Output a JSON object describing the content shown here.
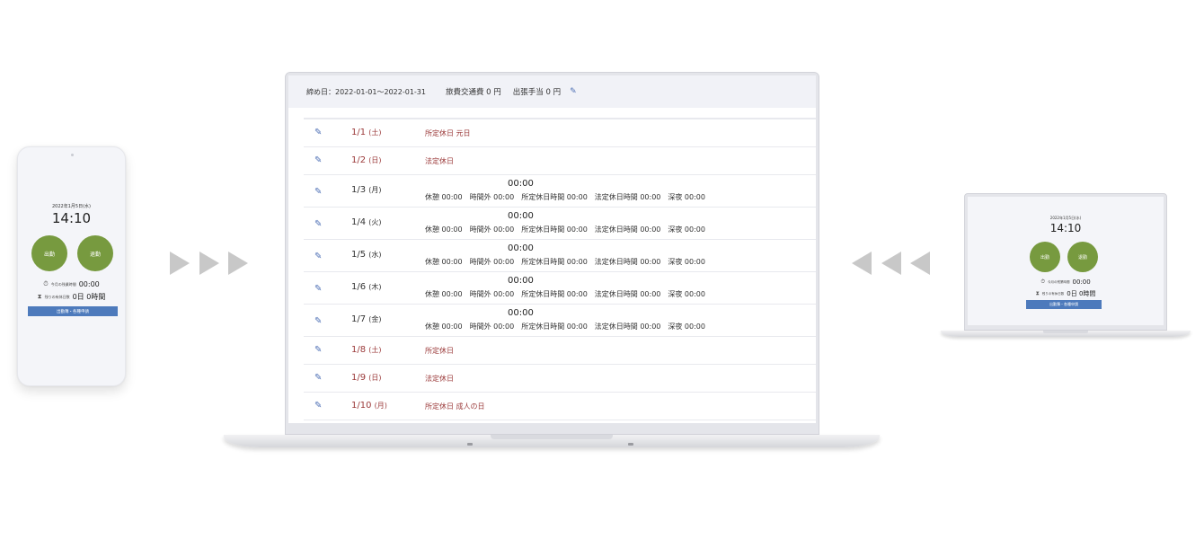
{
  "phone": {
    "date": "2022年1月5日(水)",
    "clock": "14:10",
    "clock_in_label": "出勤",
    "clock_out_label": "退勤",
    "overtime_label": "今月の残業時間",
    "overtime_value": "00:00",
    "leave_label": "残りの有休日数",
    "leave_value": "0日 0時間",
    "request_button": "出勤簿・各種申請"
  },
  "laptop": {
    "header": {
      "period": "締め日：2022-01-01〜2022-01-31",
      "travel": "旅費交通費 0 円",
      "allowance": "出張手当 0 円"
    },
    "rows": [
      {
        "kind": "holiday",
        "date": "1/1",
        "weekday": "(土)",
        "note": "所定休日 元日"
      },
      {
        "kind": "holiday",
        "date": "1/2",
        "weekday": "(日)",
        "note": "法定休日"
      },
      {
        "kind": "work",
        "date": "1/3",
        "weekday": "(月)",
        "time": "00:00",
        "detail": "休憩 00:00　時間外 00:00　所定休日時間 00:00　法定休日時間 00:00　深夜 00:00"
      },
      {
        "kind": "work",
        "date": "1/4",
        "weekday": "(火)",
        "time": "00:00",
        "detail": "休憩 00:00　時間外 00:00　所定休日時間 00:00　法定休日時間 00:00　深夜 00:00"
      },
      {
        "kind": "work",
        "date": "1/5",
        "weekday": "(水)",
        "time": "00:00",
        "detail": "休憩 00:00　時間外 00:00　所定休日時間 00:00　法定休日時間 00:00　深夜 00:00"
      },
      {
        "kind": "work",
        "date": "1/6",
        "weekday": "(木)",
        "time": "00:00",
        "detail": "休憩 00:00　時間外 00:00　所定休日時間 00:00　法定休日時間 00:00　深夜 00:00"
      },
      {
        "kind": "work",
        "date": "1/7",
        "weekday": "(金)",
        "time": "00:00",
        "detail": "休憩 00:00　時間外 00:00　所定休日時間 00:00　法定休日時間 00:00　深夜 00:00"
      },
      {
        "kind": "holiday",
        "date": "1/8",
        "weekday": "(土)",
        "note": "所定休日"
      },
      {
        "kind": "holiday",
        "date": "1/9",
        "weekday": "(日)",
        "note": "法定休日"
      },
      {
        "kind": "holiday",
        "date": "1/10",
        "weekday": "(月)",
        "note": "所定休日 成人の日"
      }
    ]
  },
  "small_laptop": {
    "date": "2022年1月5日(水)",
    "clock": "14:10",
    "clock_in_label": "出勤",
    "clock_out_label": "退勤",
    "overtime_label": "今月の残業時間",
    "overtime_value": "00:00",
    "leave_label": "残りの有休日数",
    "leave_value": "0日 0時間",
    "request_button": "出勤簿・各種申請"
  },
  "colors": {
    "accent_green": "#779a3f",
    "button_blue": "#4d7abc",
    "holiday_red": "#9b3a3a",
    "edit_icon_blue": "#4d6fb5",
    "arrow_gray": "#c8c8c8"
  },
  "icons": {
    "edit": "pencil-icon",
    "overtime": "stopwatch-icon",
    "leave": "hourglass-icon",
    "arrows": "triangle-arrow-icon"
  }
}
